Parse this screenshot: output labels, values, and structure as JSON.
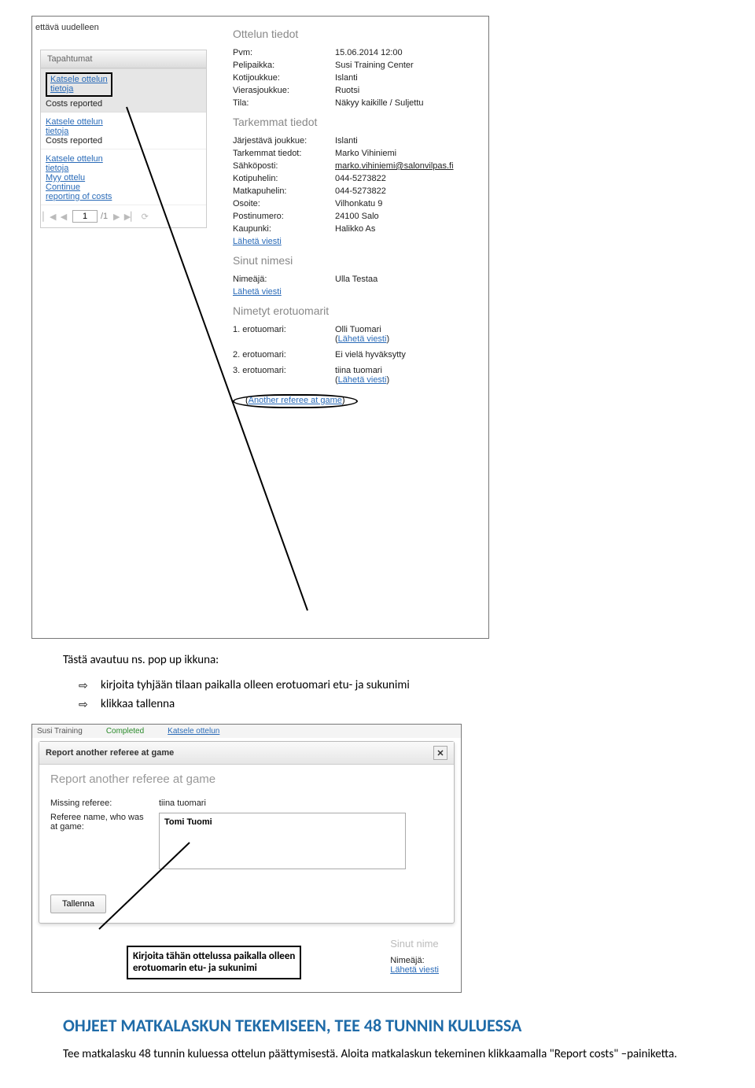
{
  "shot1": {
    "trunc_header": "ettävä uudelleen",
    "sub_header": "Tapahtumat",
    "box_link1": "Katsele ottelun",
    "box_link2": "tietoja",
    "box_sub": "Costs reported",
    "entry2_l1": "Katsele ottelun",
    "entry2_l2": "tietoja",
    "entry2_l3": "Costs reported",
    "entry3_l1": "Katsele ottelun",
    "entry3_l2": "tietoja",
    "entry3_l3": "Myy ottelu",
    "entry3_l4": "Continue",
    "entry3_l5": "reporting of costs",
    "pager_val": "1",
    "pager_total": "/1",
    "sec1": "Ottelun tiedot",
    "r1k": "Pvm:",
    "r1v": "15.06.2014 12:00",
    "r2k": "Pelipaikka:",
    "r2v": "Susi Training Center",
    "r3k": "Kotijoukkue:",
    "r3v": "Islanti",
    "r4k": "Vierasjoukkue:",
    "r4v": "Ruotsi",
    "r5k": "Tila:",
    "r5v": "Näkyy kaikille / Suljettu",
    "sec2": "Tarkemmat tiedot",
    "r6k": "Järjestävä joukkue:",
    "r6v": "Islanti",
    "r7k": "Tarkemmat tiedot:",
    "r7v": "Marko Vihiniemi",
    "r8k": "Sähköposti:",
    "r8v": "marko.vihiniemi@salonvilpas.fi",
    "r9k": "Kotipuhelin:",
    "r9v": "044-5273822",
    "r10k": "Matkapuhelin:",
    "r10v": "044-5273822",
    "r11k": "Osoite:",
    "r11v": "Vilhonkatu 9",
    "r12k": "Postinumero:",
    "r12v": "24100 Salo",
    "r13k": "Kaupunki:",
    "r13v": "Halikko As",
    "r14link": "Lähetä viesti",
    "sec3": "Sinut nimesi",
    "r15k": "Nimeäjä:",
    "r15v": "Ulla Testaa",
    "r16link": "Lähetä viesti",
    "sec4": "Nimetyt erotuomarit",
    "ref1k": "1. erotuomari:",
    "ref1v": "Olli Tuomari",
    "ref1l": "Lähetä viesti",
    "ref2k": "2. erotuomari:",
    "ref2v": "Ei vielä hyväksytty",
    "ref3k": "3. erotuomari:",
    "ref3v": "tiina tuomari",
    "ref3l": "Lähetä viesti",
    "bottomlink": "Another referee at game"
  },
  "doc": {
    "p1": "Tästä avautuu ns. pop up ikkuna:",
    "b1": "kirjoita tyhjään tilaan paikalla olleen erotuomari etu- ja sukunimi",
    "b2": "klikkaa tallenna"
  },
  "shot2": {
    "strip1": "Susi Training",
    "strip2": "Completed",
    "strip3": "Katsele ottelun",
    "title": "Report another referee at game",
    "subtitle": "Report another referee at game",
    "f1k": "Missing referee:",
    "f1v": "tiina tuomari",
    "f2k": "Referee name, who was at game:",
    "f2v": "Tomi Tuomi",
    "btn": "Tallenna",
    "note_l1": "Kirjoita tähän ottelussa paikalla olleen",
    "note_l2": "erotuomarin etu- ja sukunimi",
    "side_title": "Sinut nime",
    "side_k": "Nimeäjä:",
    "side_link": "Lähetä viesti"
  },
  "heading": "OHJEET MATKALASKUN TEKEMISEEN, TEE 48 TUNNIN KULUESSA",
  "para": "Tee matkalasku 48 tunnin kuluessa ottelun päättymisestä. Aloita matkalaskun tekeminen klikkaamalla \"Report costs\" –painiketta."
}
